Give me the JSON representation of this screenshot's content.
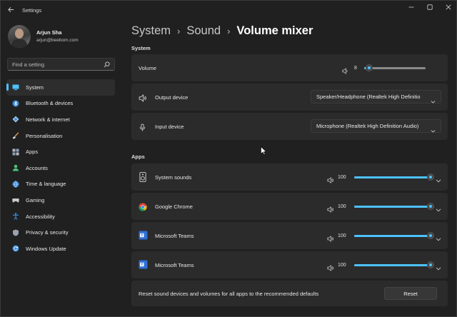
{
  "window": {
    "title": "Settings",
    "controls": [
      "minimize-icon",
      "maximize-icon",
      "close-icon"
    ]
  },
  "profile": {
    "name": "Arjun Sha",
    "email": "arjun@beebom.com"
  },
  "search": {
    "placeholder": "Find a setting"
  },
  "nav": {
    "items": [
      {
        "label": "System",
        "icon": "system-icon",
        "active": true
      },
      {
        "label": "Bluetooth & devices",
        "icon": "bluetooth-icon"
      },
      {
        "label": "Network & internet",
        "icon": "network-icon"
      },
      {
        "label": "Personalisation",
        "icon": "brush-icon"
      },
      {
        "label": "Apps",
        "icon": "apps-icon"
      },
      {
        "label": "Accounts",
        "icon": "accounts-icon"
      },
      {
        "label": "Time & language",
        "icon": "globe-icon"
      },
      {
        "label": "Gaming",
        "icon": "gaming-icon"
      },
      {
        "label": "Accessibility",
        "icon": "accessibility-icon"
      },
      {
        "label": "Privacy & security",
        "icon": "shield-icon"
      },
      {
        "label": "Windows Update",
        "icon": "update-icon"
      }
    ]
  },
  "breadcrumb": {
    "items": [
      "System",
      "Sound",
      "Volume mixer"
    ]
  },
  "system": {
    "heading": "System",
    "volume": {
      "label": "Volume",
      "value": "8",
      "level": 0.08
    },
    "output": {
      "label": "Output device",
      "value": "Speaker/Headphone (Realtek High Definitio"
    },
    "input": {
      "label": "Input device",
      "value": "Microphone (Realtek High Definition Audio)"
    }
  },
  "apps": {
    "heading": "Apps",
    "items": [
      {
        "name": "System sounds",
        "volume": "100",
        "level": 1.0,
        "icon": "system-sounds-icon"
      },
      {
        "name": "Google Chrome",
        "volume": "100",
        "level": 1.0,
        "icon": "chrome-icon"
      },
      {
        "name": "Microsoft Teams",
        "volume": "100",
        "level": 1.0,
        "icon": "teams-icon"
      },
      {
        "name": "Microsoft Teams",
        "volume": "100",
        "level": 1.0,
        "icon": "teams-icon"
      }
    ]
  },
  "reset": {
    "text": "Reset sound devices and volumes for all apps to the recommended defaults",
    "button": "Reset"
  },
  "colors": {
    "accent": "#4cc2ff",
    "background": "#202020",
    "card": "#2b2b2b"
  }
}
